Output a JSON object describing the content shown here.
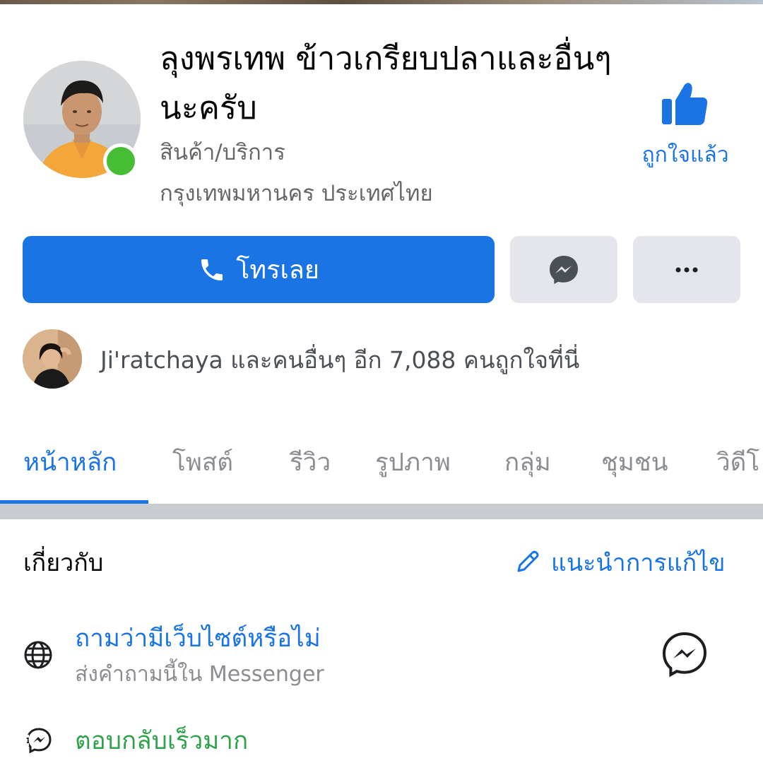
{
  "page": {
    "title": "ลุงพรเทพ ข้าวเกรียบปลาและอื่นๆนะครับ",
    "category": "สินค้า/บริการ",
    "location": "กรุงเทพมหานคร ประเทศไทย",
    "online": true
  },
  "liked": {
    "label": "ถูกใจแล้ว",
    "icon": "thumbs-up-icon"
  },
  "actions": {
    "call_label": "โทรเลย",
    "call_icon": "phone-icon",
    "message_icon": "messenger-icon",
    "more_icon": "more-dots-icon"
  },
  "friends": {
    "text": "Ji'ratchaya และคนอื่นๆ อีก 7,088 คนถูกใจที่นี่"
  },
  "tabs": [
    {
      "label": "หน้าหลัก",
      "active": true
    },
    {
      "label": "โพสต์"
    },
    {
      "label": "รีวิว"
    },
    {
      "label": "รูปภาพ"
    },
    {
      "label": "กลุ่ม"
    },
    {
      "label": "ชุมชน"
    },
    {
      "label": "วิดีโ"
    }
  ],
  "about": {
    "heading": "เกี่ยวกับ",
    "suggest_edit": "แนะนำการแก้ไข",
    "website_link": "ถามว่ามีเว็บไซต์หรือไม่",
    "website_sub": "ส่งคำถามนี้ใน Messenger",
    "response": "ตอบกลับเร็วมาก"
  },
  "colors": {
    "accent": "#1b74e4",
    "online": "#45bd35",
    "response": "#31a24c",
    "secondary_text": "#65676b",
    "button_gray": "#e4e6eb"
  }
}
